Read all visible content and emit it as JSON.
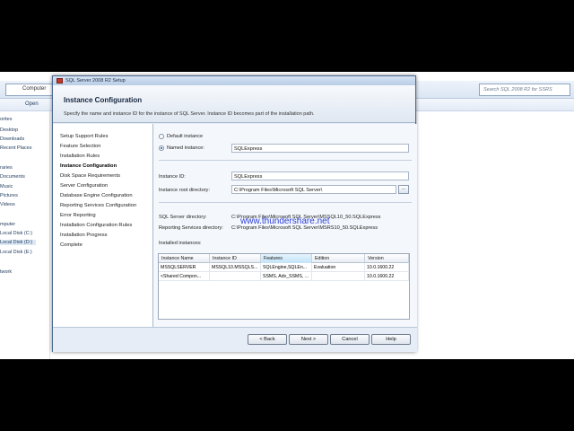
{
  "explorer": {
    "address_text": "Computer",
    "search_placeholder": "Search SQL 2008 R2 for SSRS",
    "open_label": "Open",
    "nav_items": [
      "orites",
      "Desktop",
      "Downloads",
      "Recent Places",
      "raries",
      "Documents",
      "Music",
      "Pictures",
      "Videos",
      "mputer",
      "Local Disk (C:)",
      "Local Disk (D:)",
      "Local Disk (E:)",
      "twork"
    ]
  },
  "dialog": {
    "title": "SQL Server 2008 R2 Setup",
    "header_title": "Instance Configuration",
    "header_subtitle": "Specify the name and instance ID for the instance of SQL Server. Instance ID becomes part of the installation path.",
    "steps": [
      "Setup Support Rules",
      "Feature Selection",
      "Installation Rules",
      "Instance Configuration",
      "Disk Space Requirements",
      "Server Configuration",
      "Database Engine Configuration",
      "Reporting Services Configuration",
      "Error Reporting",
      "Installation Configuration Rules",
      "Installation Progress",
      "Complete"
    ],
    "active_step": "Instance Configuration",
    "default_instance_label": "Default instance",
    "named_instance_label": "Named instance:",
    "named_instance_value": "SQLExpress",
    "instance_id_label": "Instance ID:",
    "instance_id_value": "SQLExpress",
    "root_dir_label": "Instance root directory:",
    "root_dir_value": "C:\\Program Files\\Microsoft SQL Server\\",
    "browse_label": "...",
    "sql_dir_label": "SQL Server directory:",
    "sql_dir_value": "C:\\Program Files\\Microsoft SQL Server\\MSSQL10_50.SQLExpress",
    "rs_dir_label": "Reporting Services directory:",
    "rs_dir_value": "C:\\Program Files\\Microsoft SQL Server\\MSRS10_50.SQLExpress",
    "installed_label": "Installed instances:",
    "table": {
      "columns": [
        "Instance Name",
        "Instance ID",
        "Features",
        "Edition",
        "Version"
      ],
      "rows": [
        [
          "MSSQLSERVER",
          "MSSQL10.MSSQLS...",
          "SQLEngine,SQLEn...",
          "Evaluation",
          "10.0.1600.22"
        ],
        [
          "<Shared Compon...",
          "",
          "SSMS, Adv_SSMS, ...",
          "",
          "10.0.1600.22"
        ]
      ]
    },
    "buttons": {
      "back": "< Back",
      "next": "Next >",
      "cancel": "Cancel",
      "help": "Help"
    }
  },
  "watermark": "www.thundershare.net"
}
